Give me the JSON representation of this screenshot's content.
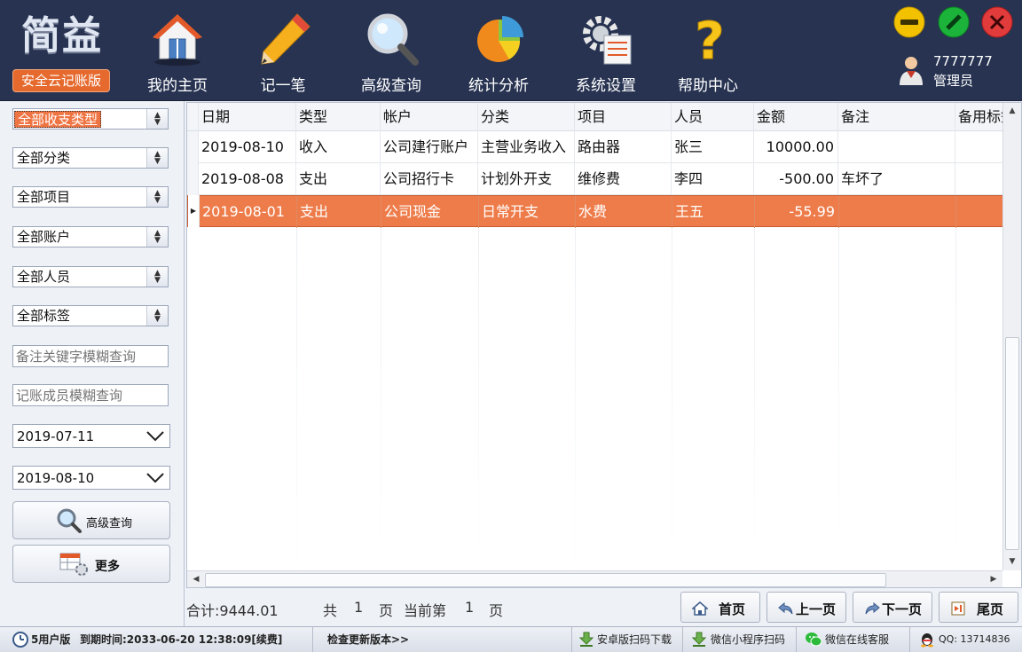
{
  "app": {
    "logo_text": "简益",
    "edition": "安全云记账版"
  },
  "nav": [
    {
      "label": "我的主页",
      "icon": "home-icon"
    },
    {
      "label": "记一笔",
      "icon": "pencil-icon"
    },
    {
      "label": "高级查询",
      "icon": "magnifier-icon"
    },
    {
      "label": "统计分析",
      "icon": "pie-chart-icon"
    },
    {
      "label": "系统设置",
      "icon": "gear-icon"
    },
    {
      "label": "帮助中心",
      "icon": "question-icon"
    }
  ],
  "window_buttons": {
    "minimize_color": "#f2c200",
    "maximize_color": "#1bb33a",
    "close_color": "#e23b3b"
  },
  "user": {
    "id": "7777777",
    "role": "管理员"
  },
  "filters": {
    "type": "全部收支类型",
    "category": "全部分类",
    "project": "全部项目",
    "account": "全部账户",
    "person": "全部人员",
    "tag": "全部标签",
    "note_placeholder": "备注关键字模糊查询",
    "member_placeholder": "记账成员模糊查询",
    "date_from": "2019-07-11",
    "date_to": "2019-08-10",
    "advanced_query_label": "高级查询",
    "more_label": "更多"
  },
  "table": {
    "columns": [
      "日期",
      "类型",
      "帐户",
      "分类",
      "项目",
      "人员",
      "金额",
      "备注",
      "备用标签"
    ],
    "rows": [
      {
        "date": "2019-08-10",
        "type": "收入",
        "account": "公司建行账户",
        "category": "主营业务收入",
        "project": "路由器",
        "person": "张三",
        "amount": "10000.00",
        "note": "",
        "tag": ""
      },
      {
        "date": "2019-08-08",
        "type": "支出",
        "account": "公司招行卡",
        "category": "计划外开支",
        "project": "维修费",
        "person": "李四",
        "amount": "-500.00",
        "note": "车坏了",
        "tag": ""
      },
      {
        "date": "2019-08-01",
        "type": "支出",
        "account": "公司现金",
        "category": "日常开支",
        "project": "水费",
        "person": "王五",
        "amount": "-55.99",
        "note": "",
        "tag": ""
      }
    ],
    "selected_row": 2,
    "selected_color": "#ee7c4a"
  },
  "summary": {
    "total": "合计:9444.01",
    "total_pages_prefix": "共",
    "total_pages": "1",
    "page_unit": "页",
    "current_prefix": "当前第",
    "current_page": "1",
    "current_suffix": "页"
  },
  "pager": {
    "first": "首页",
    "prev": "上一页",
    "next": "下一页",
    "last": "尾页"
  },
  "statusbar": {
    "license": "5用户版",
    "expire": "到期时间:2033-06-20 12:38:09[续费]",
    "update": "检查更新版本>>",
    "android": "安卓版扫码下载",
    "miniapp": "微信小程序扫码",
    "service": "微信在线客服",
    "qq": "QQ: 13714836"
  }
}
